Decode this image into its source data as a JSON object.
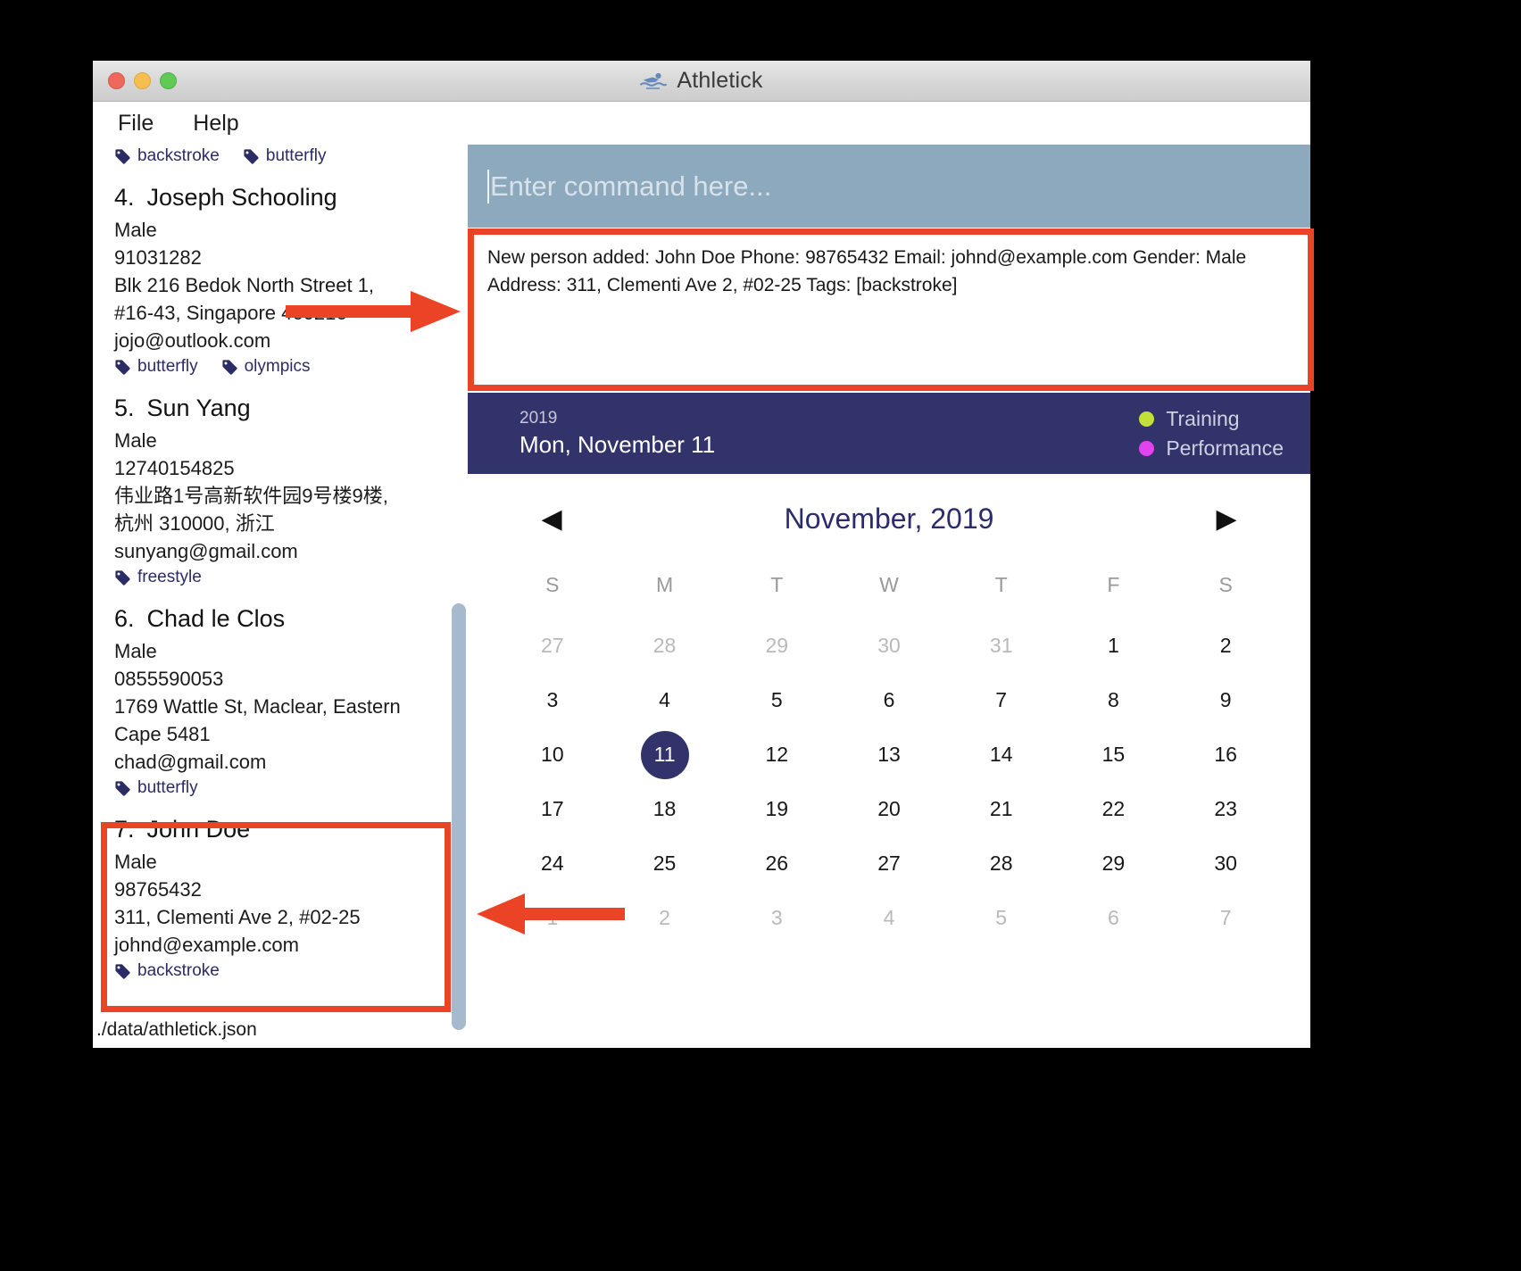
{
  "window": {
    "title": "Athletick",
    "logo_icon": "swimmer-icon",
    "traffic_lights": [
      "close-red",
      "minimize-yellow",
      "zoom-green"
    ]
  },
  "menubar": {
    "items": [
      {
        "label": "File"
      },
      {
        "label": "Help"
      }
    ]
  },
  "sidebar": {
    "top_tags": [
      {
        "label": "backstroke",
        "icon": "tag-icon"
      },
      {
        "label": "butterfly",
        "icon": "tag-icon"
      }
    ],
    "persons": [
      {
        "index": "4.",
        "name": "Joseph Schooling",
        "gender": "Male",
        "phone": "91031282",
        "address_lines": [
          "Blk 216 Bedok North Street 1,",
          "#16-43, Singapore 460216"
        ],
        "email": "jojo@outlook.com",
        "tags": [
          "butterfly",
          "olympics"
        ]
      },
      {
        "index": "5.",
        "name": "Sun Yang",
        "gender": "Male",
        "phone": "12740154825",
        "address_lines": [
          "伟业路1号高新软件园9号楼9楼,",
          "杭州 310000, 浙江"
        ],
        "email": "sunyang@gmail.com",
        "tags": [
          "freestyle"
        ]
      },
      {
        "index": "6.",
        "name": "Chad le Clos",
        "gender": "Male",
        "phone": "0855590053",
        "address_lines": [
          "1769 Wattle St, Maclear, Eastern",
          "Cape 5481"
        ],
        "email": "chad@gmail.com",
        "tags": [
          "butterfly"
        ]
      },
      {
        "index": "7.",
        "name": "John Doe",
        "gender": "Male",
        "phone": "98765432",
        "address_lines": [
          "311, Clementi Ave 2, #02-25"
        ],
        "email": "johnd@example.com",
        "tags": [
          "backstroke"
        ]
      }
    ],
    "status_path": "./data/athletick.json"
  },
  "command": {
    "placeholder": "Enter command here...",
    "value": ""
  },
  "result": {
    "text": "New person added: John Doe Phone: 98765432 Email: johnd@example.com Gender: Male Address: 311, Clementi Ave 2, #02-25 Tags: [backstroke]"
  },
  "date_header": {
    "year": "2019",
    "date": "Mon, November 11",
    "legend": [
      {
        "label": "Training",
        "color": "#c3e03a"
      },
      {
        "label": "Performance",
        "color": "#e143ef"
      }
    ]
  },
  "calendar": {
    "prev_icon": "chevron-left-icon",
    "next_icon": "chevron-right-icon",
    "month_label": "November, 2019",
    "day_headers": [
      "S",
      "M",
      "T",
      "W",
      "T",
      "F",
      "S"
    ],
    "selected_day": 11,
    "weeks": [
      [
        {
          "day": "27",
          "muted": true
        },
        {
          "day": "28",
          "muted": true
        },
        {
          "day": "29",
          "muted": true
        },
        {
          "day": "30",
          "muted": true
        },
        {
          "day": "31",
          "muted": true
        },
        {
          "day": "1",
          "muted": false
        },
        {
          "day": "2",
          "muted": false
        }
      ],
      [
        {
          "day": "3",
          "muted": false
        },
        {
          "day": "4",
          "muted": false
        },
        {
          "day": "5",
          "muted": false
        },
        {
          "day": "6",
          "muted": false
        },
        {
          "day": "7",
          "muted": false
        },
        {
          "day": "8",
          "muted": false
        },
        {
          "day": "9",
          "muted": false
        }
      ],
      [
        {
          "day": "10",
          "muted": false
        },
        {
          "day": "11",
          "muted": false,
          "today": true
        },
        {
          "day": "12",
          "muted": false
        },
        {
          "day": "13",
          "muted": false
        },
        {
          "day": "14",
          "muted": false
        },
        {
          "day": "15",
          "muted": false
        },
        {
          "day": "16",
          "muted": false
        }
      ],
      [
        {
          "day": "17",
          "muted": false
        },
        {
          "day": "18",
          "muted": false
        },
        {
          "day": "19",
          "muted": false
        },
        {
          "day": "20",
          "muted": false
        },
        {
          "day": "21",
          "muted": false
        },
        {
          "day": "22",
          "muted": false
        },
        {
          "day": "23",
          "muted": false
        }
      ],
      [
        {
          "day": "24",
          "muted": false
        },
        {
          "day": "25",
          "muted": false
        },
        {
          "day": "26",
          "muted": false
        },
        {
          "day": "27",
          "muted": false
        },
        {
          "day": "28",
          "muted": false
        },
        {
          "day": "29",
          "muted": false
        },
        {
          "day": "30",
          "muted": false
        }
      ],
      [
        {
          "day": "1",
          "muted": true
        },
        {
          "day": "2",
          "muted": true
        },
        {
          "day": "3",
          "muted": true
        },
        {
          "day": "4",
          "muted": true
        },
        {
          "day": "5",
          "muted": true
        },
        {
          "day": "6",
          "muted": true
        },
        {
          "day": "7",
          "muted": true
        }
      ]
    ]
  },
  "annotations": {
    "highlight_color": "#ea4326",
    "boxes": [
      "result-box-highlight",
      "john-doe-entry-highlight"
    ],
    "arrows": [
      "arrow-to-result-box",
      "arrow-to-john-doe-entry"
    ]
  }
}
